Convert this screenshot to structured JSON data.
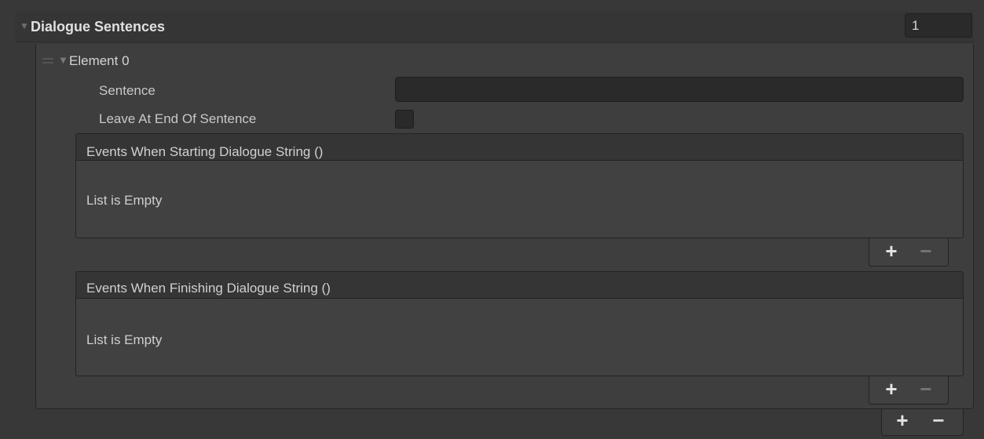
{
  "list": {
    "title": "Dialogue Sentences",
    "size": "1",
    "fold_icon": "triangle-down-icon"
  },
  "element": {
    "label": "Element 0",
    "drag_icon": "drag-handle-icon",
    "fold_icon": "triangle-down-icon",
    "sentence_label": "Sentence",
    "sentence_value": "",
    "leave_label": "Leave At End Of Sentence",
    "leave_checked": false
  },
  "events_start": {
    "title": "Events When Starting Dialogue String ()",
    "empty_text": "List is Empty",
    "add_label": "+",
    "remove_label": "−"
  },
  "events_finish": {
    "title": "Events When Finishing Dialogue String ()",
    "empty_text": "List is Empty",
    "add_label": "+",
    "remove_label": "−"
  },
  "list_controls": {
    "add_label": "+",
    "remove_label": "−"
  }
}
